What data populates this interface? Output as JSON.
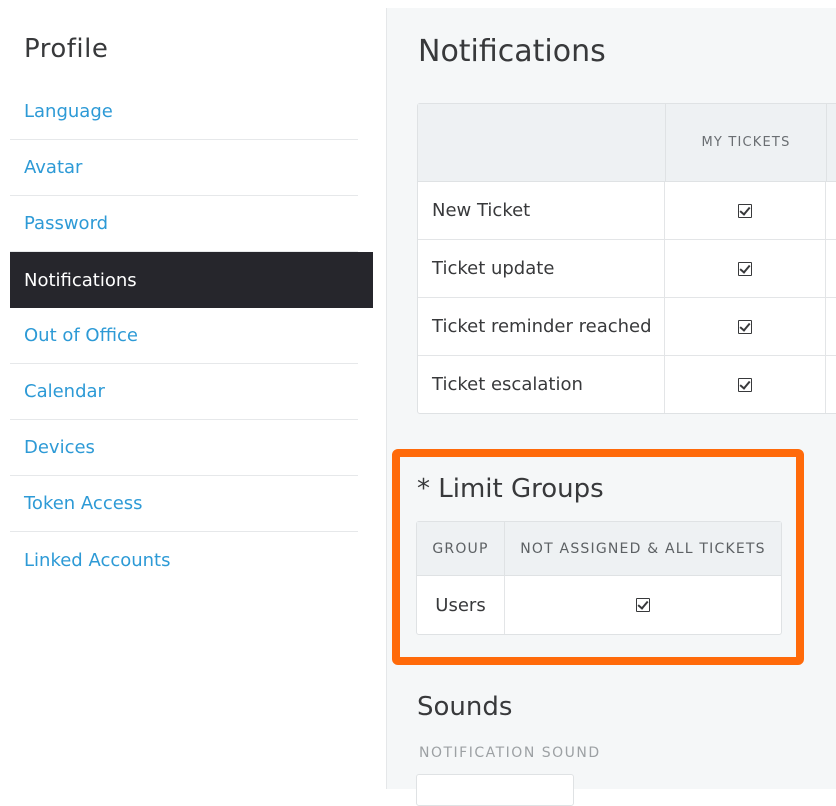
{
  "sidebar": {
    "title": "Profile",
    "items": [
      {
        "label": "Language"
      },
      {
        "label": "Avatar"
      },
      {
        "label": "Password"
      },
      {
        "label": "Notifications",
        "active": true
      },
      {
        "label": "Out of Office"
      },
      {
        "label": "Calendar"
      },
      {
        "label": "Devices"
      },
      {
        "label": "Token Access"
      },
      {
        "label": "Linked Accounts"
      }
    ]
  },
  "main": {
    "title": "Notifications",
    "table": {
      "column_header": "MY TICKETS",
      "rows": [
        {
          "label": "New Ticket",
          "checked": true
        },
        {
          "label": "Ticket update",
          "checked": true
        },
        {
          "label": "Ticket reminder reached",
          "checked": true
        },
        {
          "label": "Ticket escalation",
          "checked": true
        }
      ]
    },
    "limit_groups": {
      "title": "* Limit Groups",
      "headers": [
        "GROUP",
        "NOT ASSIGNED & ALL TICKETS"
      ],
      "rows": [
        {
          "group": "Users",
          "checked": true
        }
      ]
    },
    "sounds": {
      "title": "Sounds",
      "label": "NOTIFICATION SOUND"
    }
  },
  "colors": {
    "accent": "#2d9ad6",
    "active_bg": "#26262c",
    "highlight": "#ff6a0a",
    "panel_bg": "#f5f7f8"
  }
}
